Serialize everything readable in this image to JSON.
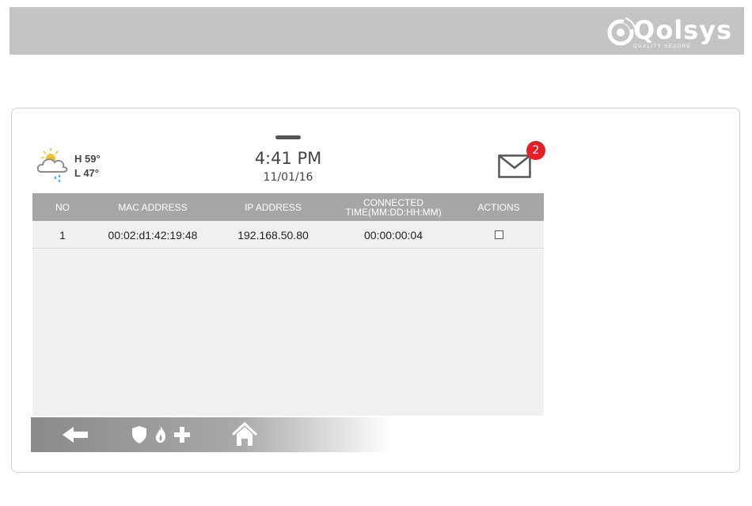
{
  "header": {
    "brand": "Qolsys",
    "tagline": "QUALITY SECURE"
  },
  "weather": {
    "high": "H 59°",
    "low": "L 47°",
    "icon": "cloud-rain-sun-icon"
  },
  "clock": {
    "time": "4:41 PM",
    "date": "11/01/16"
  },
  "messages": {
    "icon": "mail-icon",
    "badge_count": "2",
    "badge_color": "#e42024"
  },
  "table": {
    "columns": [
      "NO",
      "MAC ADDRESS",
      "IP ADDRESS",
      "CONNECTED",
      "TIME(MM:DD:HH:MM)",
      "ACTIONS"
    ],
    "rows": [
      {
        "no": "1",
        "mac": "00:02:d1:42:19:48",
        "ip": "192.168.50.80",
        "connected": "00:00:00:04",
        "checked": false
      }
    ]
  },
  "nav": {
    "back": "back-arrow-icon",
    "emergency": [
      "shield-icon",
      "fire-icon",
      "medical-cross-icon"
    ],
    "home": "home-icon"
  },
  "colors": {
    "banner": "#c4c4c4",
    "header_row": "#a6a6a6",
    "table_bg": "#f0f0f0"
  }
}
